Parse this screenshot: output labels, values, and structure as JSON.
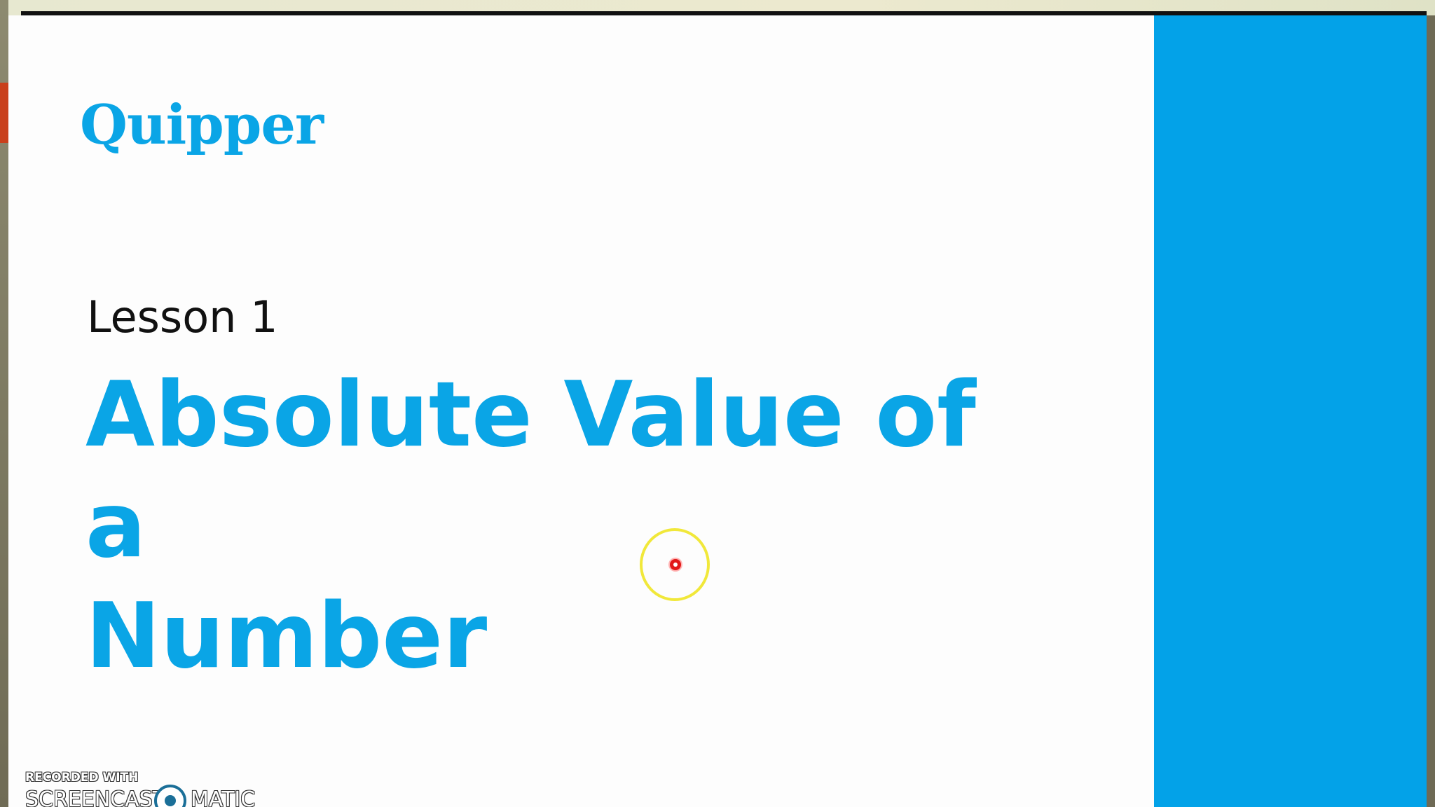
{
  "slide": {
    "logo_text": "Quipper",
    "lesson_label": "Lesson 1",
    "title_line_1": "Absolute Value of a",
    "title_line_2": "Number",
    "accent_color": "#03a2e8",
    "title_color": "#0aa5e6"
  },
  "watermark": {
    "recorded_with": "RECORDED WITH",
    "brand_left": "SCREENCAST",
    "brand_right": "MATIC"
  },
  "cursor": {
    "icon": "click-highlight-icon"
  }
}
